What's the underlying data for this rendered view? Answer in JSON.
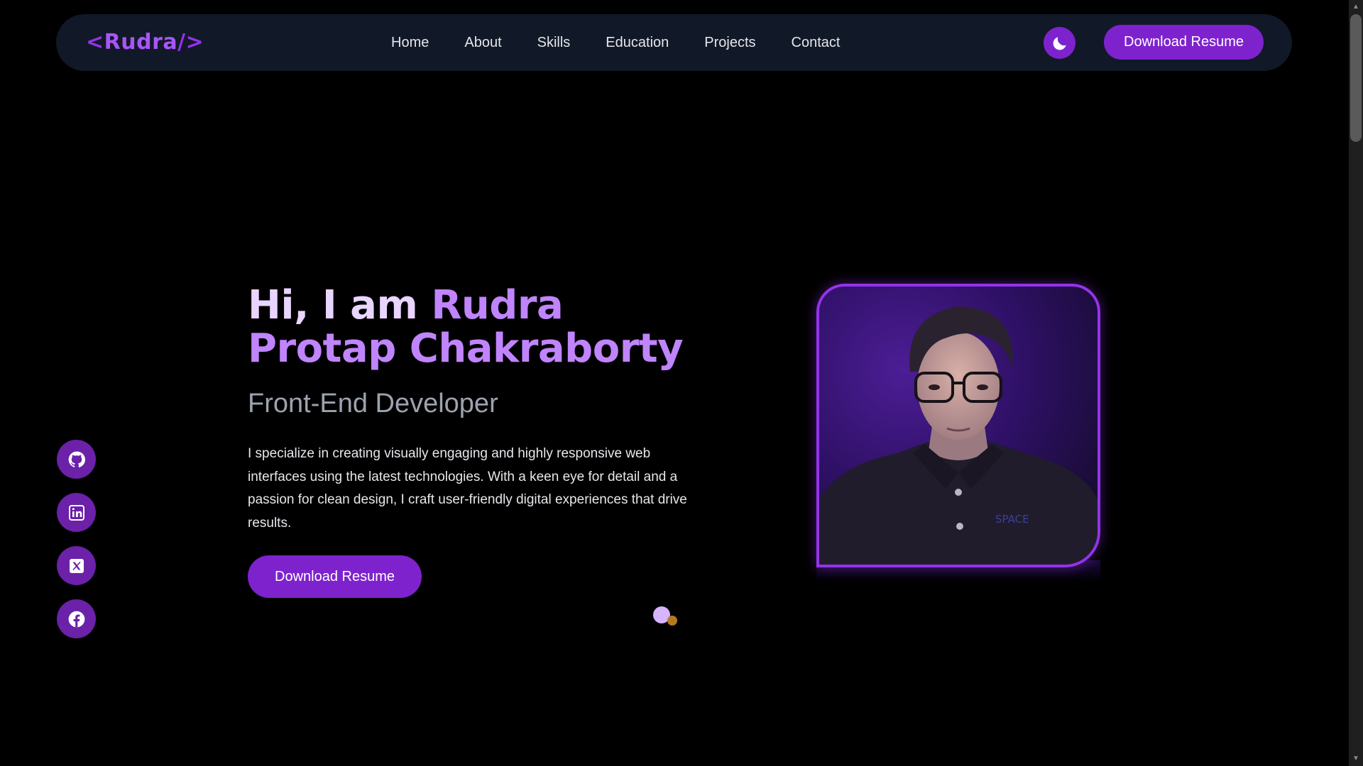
{
  "nav": {
    "logo": {
      "open": "<",
      "name": "Rudra",
      "close": "/>"
    },
    "links": [
      "Home",
      "About",
      "Skills",
      "Education",
      "Projects",
      "Contact"
    ],
    "theme_toggle_icon": "moon-icon",
    "resume_label": "Download Resume"
  },
  "hero": {
    "title_lead": "Hi, I am ",
    "title_name": "Rudra Protap Chakraborty",
    "role": "Front-End Developer",
    "description": "I specialize in creating visually engaging and highly responsive web interfaces using the latest technologies. With a keen eye for detail and a passion for clean design, I craft user-friendly digital experiences that drive results.",
    "resume_label": "Download Resume",
    "portrait_shirt_text": "SPACE"
  },
  "social": [
    {
      "name": "github-icon"
    },
    {
      "name": "linkedin-icon"
    },
    {
      "name": "x-icon"
    },
    {
      "name": "facebook-icon"
    }
  ],
  "colors": {
    "background": "#000000",
    "navbar": "#111827",
    "accent": "#7e22ce",
    "accent_light": "#c084fc",
    "title_light": "#e9d5ff",
    "role_gray": "#9ca3af"
  }
}
